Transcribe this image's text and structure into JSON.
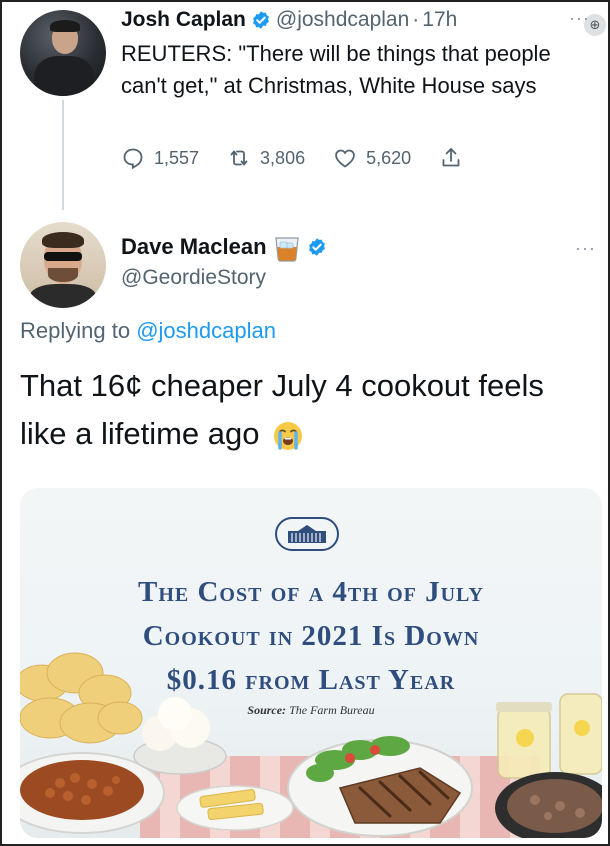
{
  "tweet1": {
    "name": "Josh Caplan",
    "handle": "@joshdcaplan",
    "separator": "·",
    "time": "17h",
    "text": "REUTERS: \"There will be things that people can't get,\" at Christmas, White House says",
    "actions": {
      "replies": "1,557",
      "retweets": "3,806",
      "likes": "5,620"
    }
  },
  "tweet2": {
    "name": "Dave Maclean",
    "handle": "@GeordieStory",
    "replying_prefix": "Replying to",
    "replying_to": "@joshdcaplan",
    "text": "That 16¢ cheaper July 4 cookout feels like a lifetime ago"
  },
  "card": {
    "headline_line1": "The Cost of a 4th of July",
    "headline_line2": "Cookout in 2021 Is Down",
    "headline_line3": "$0.16 from Last Year",
    "source_label": "Source:",
    "source_value": "The Farm Bureau"
  },
  "icons": {
    "verified": "verified-badge-icon",
    "reply": "reply-icon",
    "retweet": "retweet-icon",
    "like": "heart-icon",
    "share": "share-icon",
    "more": "more-icon",
    "whisky": "whisky-glass-emoji",
    "crying": "loudly-crying-emoji"
  },
  "colors": {
    "link": "#1d9bf0",
    "secondary_text": "#536471",
    "headline": "#2f4d7d"
  }
}
